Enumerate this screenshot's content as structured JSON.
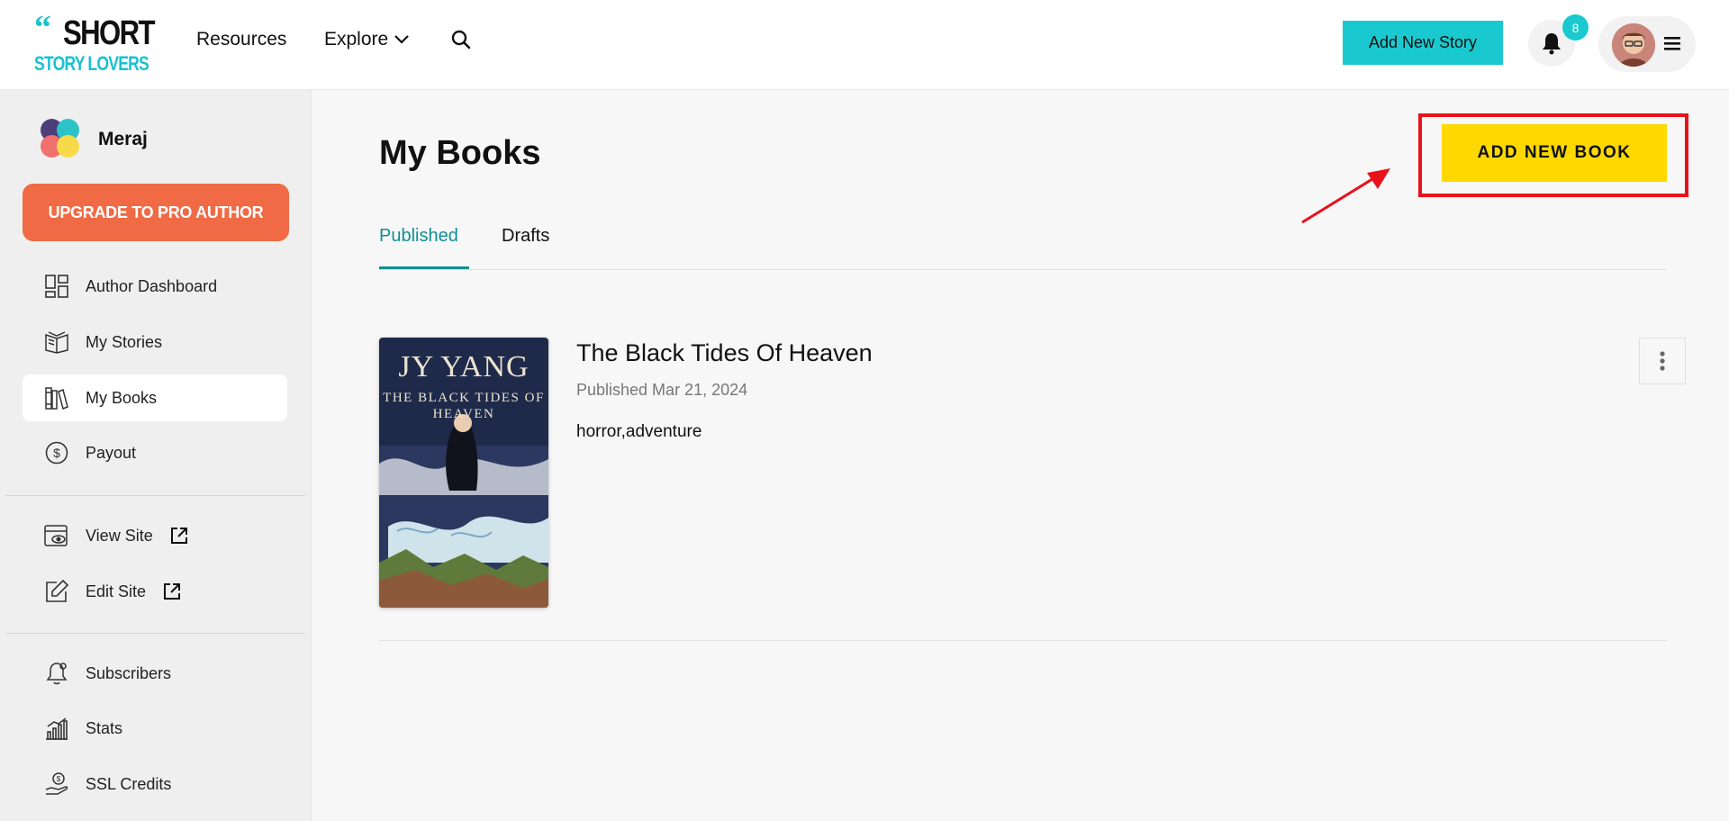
{
  "header": {
    "logo_quote": "“",
    "logo_line1": "SHORT",
    "logo_line2": "STORY LOVERS",
    "nav": {
      "resources": "Resources",
      "explore": "Explore"
    },
    "add_story_label": "Add New Story",
    "notification_count": "8"
  },
  "sidebar": {
    "profile_name": "Meraj",
    "upgrade_label": "UPGRADE TO PRO AUTHOR",
    "items": [
      {
        "label": "Author Dashboard",
        "icon": "dashboard-icon"
      },
      {
        "label": "My Stories",
        "icon": "open-book-icon"
      },
      {
        "label": "My Books",
        "icon": "books-icon",
        "active": true
      },
      {
        "label": "Payout",
        "icon": "dollar-circle-icon"
      },
      {
        "label": "View Site",
        "icon": "view-site-icon",
        "external": true
      },
      {
        "label": "Edit Site",
        "icon": "edit-icon",
        "external": true
      },
      {
        "label": "Subscribers",
        "icon": "subscribers-bell-icon"
      },
      {
        "label": "Stats",
        "icon": "stats-chart-icon"
      },
      {
        "label": "SSL Credits",
        "icon": "ssl-hand-icon"
      }
    ]
  },
  "main": {
    "title": "My Books",
    "add_book_label": "ADD NEW BOOK",
    "tabs": [
      {
        "label": "Published",
        "active": true
      },
      {
        "label": "Drafts",
        "active": false
      }
    ],
    "books": [
      {
        "title": "The Black Tides Of Heaven",
        "published": "Published Mar 21, 2024",
        "tags": "horror,adventure",
        "cover_author": "JY YANG",
        "cover_title": "THE BLACK TIDES OF HEAVEN"
      }
    ]
  },
  "colors": {
    "accent_teal": "#19c9cf",
    "upgrade_orange": "#ef6a45",
    "add_book_yellow": "#ffd800",
    "annotation_red": "#e8121c",
    "tab_active": "#0e8f93"
  }
}
